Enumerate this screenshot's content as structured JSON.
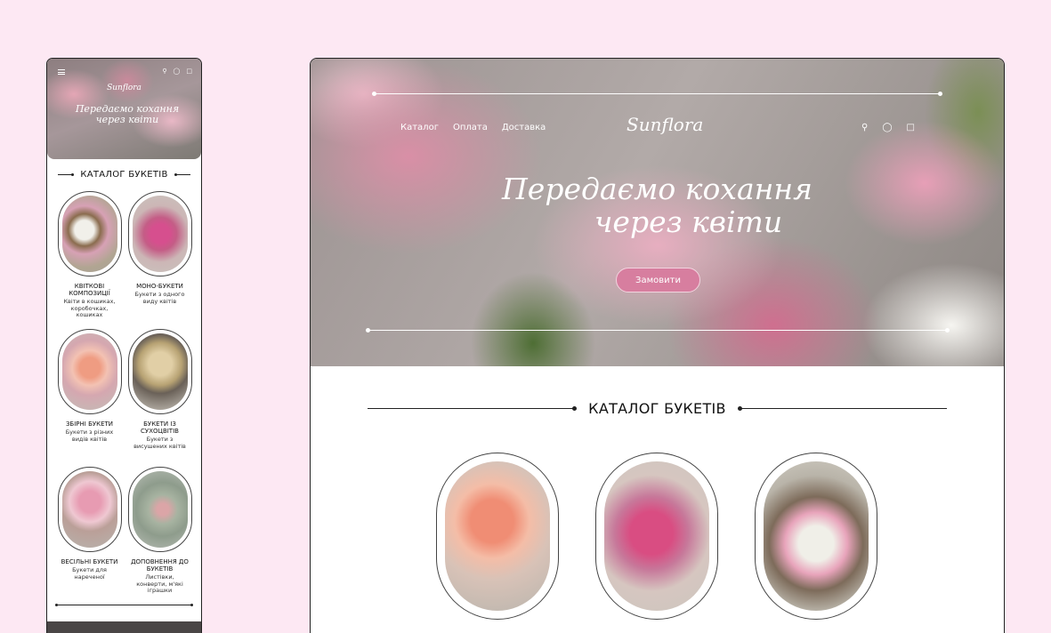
{
  "mobile": {
    "logo": "Sunflora",
    "tagline": "Передаємо кохання через квіти",
    "icons": [
      "menu-icon",
      "search-icon",
      "user-icon",
      "cart-icon"
    ],
    "section_title": "КАТАЛОГ БУКЕТІВ",
    "cards": [
      {
        "name": "Квіткові композиції",
        "desc": "Квіти в кошиках, коробочках, кошиках"
      },
      {
        "name": "Моно-букети",
        "desc": "Букети з одного виду квітів"
      },
      {
        "name": "Збірні букети",
        "desc": "Букети з різних видів квітів"
      },
      {
        "name": "Букети із сухоцвітів",
        "desc": "Букети з висушених квітів"
      },
      {
        "name": "Весільні букети",
        "desc": "Букети для нареченої"
      },
      {
        "name": "Доповнення до букетів",
        "desc": "Листівки, конверти, м'які іграшки"
      }
    ]
  },
  "desktop": {
    "nav": [
      "Каталог",
      "Оплата",
      "Доставка"
    ],
    "logo": "Sunflora",
    "icons": [
      "search-icon",
      "user-icon",
      "cart-icon"
    ],
    "tagline_line1": "Передаємо кохання",
    "tagline_line2": "через квіти",
    "order_button": "Замовити",
    "section_title": "КАТАЛОГ БУКЕТІВ"
  },
  "colors": {
    "page_background": "#fde8f3",
    "accent_button": "#d77e9f"
  }
}
